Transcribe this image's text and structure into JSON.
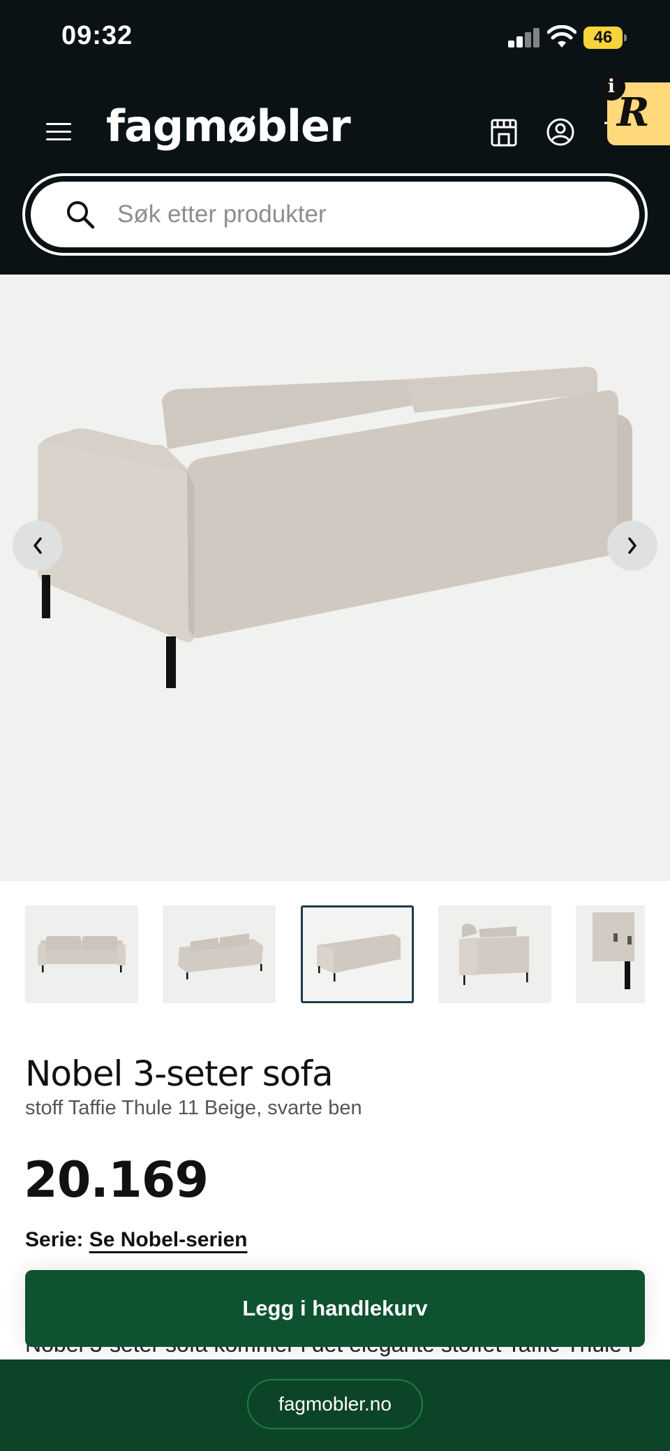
{
  "status_bar": {
    "time": "09:32",
    "battery": "46"
  },
  "header": {
    "logo": "fagmøbler",
    "icons": [
      "menu-icon",
      "store-icon",
      "account-icon",
      "cart-icon"
    ],
    "badge_letter": "R",
    "badge_info": "i"
  },
  "search": {
    "placeholder": "Søk etter produkter",
    "value": ""
  },
  "gallery": {
    "thumbnail_count": 5,
    "active_index": 2
  },
  "product": {
    "title": "Nobel 3-seter sofa",
    "subtitle": "stoff Taffie Thule 11 Beige, svarte ben",
    "price": "20.169",
    "serie_label": "Serie:",
    "serie_link": "Se Nobel-serien",
    "description_preview": "Nobel 3-seter sofa kommer i det elegante stoffet Taffie Thule i"
  },
  "cta": {
    "label": "Legg i handlekurv"
  },
  "browser": {
    "url": "fagmobler.no"
  },
  "colors": {
    "header_bg": "#0b1216",
    "cta_green": "#0e5230",
    "bottom_bar": "#0c4427",
    "battery": "#f7d43a",
    "badge": "#ffd97a",
    "sofa": "#d2cbc3"
  }
}
